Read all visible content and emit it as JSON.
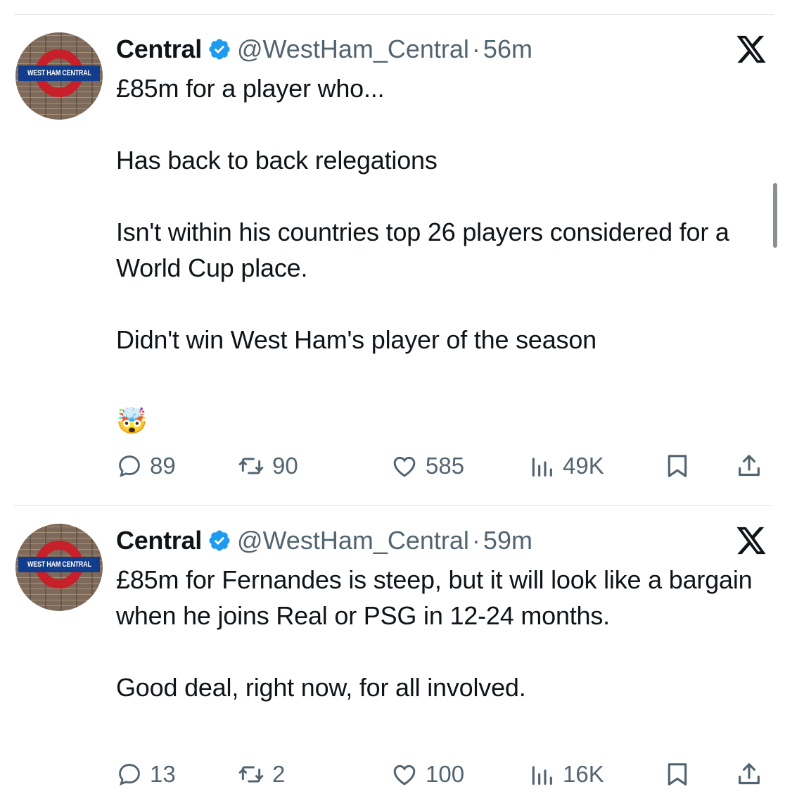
{
  "tweets": [
    {
      "display_name": "Central",
      "handle": "@WestHam_Central",
      "separator": "·",
      "time": "56m",
      "avatar_text": "WEST HAM CENTRAL",
      "body": "£85m for a player who...\n\nHas back to back relegations\n\nIsn't within his countries top 26 players considered for a World Cup place.\n\nDidn't win West Ham's player of the season",
      "emoji": "🤯",
      "replies": "89",
      "reposts": "90",
      "likes": "585",
      "views": "49K"
    },
    {
      "display_name": "Central",
      "handle": "@WestHam_Central",
      "separator": "·",
      "time": "59m",
      "avatar_text": "WEST HAM CENTRAL",
      "body": "£85m for Fernandes is steep, but it will look like a bargain when he joins Real or PSG in 12-24 months.\n\nGood deal, right now, for all involved.",
      "replies": "13",
      "reposts": "2",
      "likes": "100",
      "views": "16K"
    }
  ],
  "colors": {
    "text": "#0f1419",
    "secondary": "#536471",
    "verified": "#1d9bf0",
    "divider": "#e3e6e9"
  },
  "icons": [
    "verified-badge-icon",
    "x-logo-icon",
    "reply-icon",
    "repost-icon",
    "like-icon",
    "views-icon",
    "bookmark-icon",
    "share-icon"
  ]
}
